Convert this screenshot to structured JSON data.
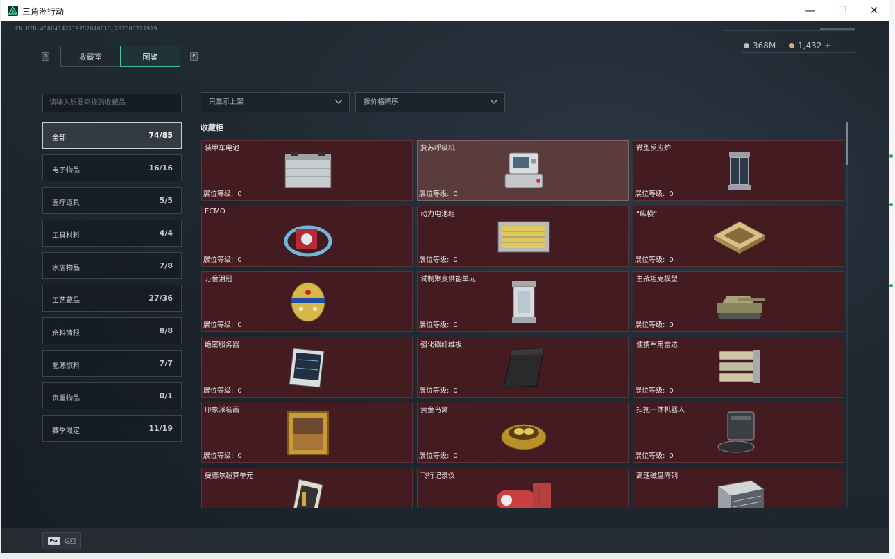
{
  "window": {
    "title": "三角洲行动",
    "minimize": "—",
    "maximize": "☐",
    "close": "✕"
  },
  "header": {
    "uid": "CN UID:4506414221925204081​3_202603221919",
    "silver": "368M",
    "gold": "1,432 +"
  },
  "tabs": {
    "key_left": "Q",
    "key_right": "E",
    "archive": "收藏室",
    "dex": "图鉴"
  },
  "filters": {
    "search_placeholder": "请输入想要查找的收藏品",
    "filter_dropdown": "只显示上架",
    "sort_dropdown": "按价格降序"
  },
  "categories": [
    {
      "name": "全部",
      "count": "74/85"
    },
    {
      "name": "电子物品",
      "count": "16/16"
    },
    {
      "name": "医疗道具",
      "count": "5/5"
    },
    {
      "name": "工具材料",
      "count": "4/4"
    },
    {
      "name": "家居物品",
      "count": "7/8"
    },
    {
      "name": "工艺藏品",
      "count": "27/36"
    },
    {
      "name": "资料情报",
      "count": "8/8"
    },
    {
      "name": "能源燃料",
      "count": "7/7"
    },
    {
      "name": "贵重物品",
      "count": "0/1"
    },
    {
      "name": "赛季限定",
      "count": "11/19"
    }
  ],
  "section": {
    "title": "收藏柜"
  },
  "level_label": "展位等级:",
  "items": [
    {
      "name": "装甲车电池",
      "level": "0",
      "icon": "battery-icon"
    },
    {
      "name": "复苏呼吸机",
      "level": "0",
      "icon": "ventilator-icon"
    },
    {
      "name": "微型反应炉",
      "level": "0",
      "icon": "reactor-icon"
    },
    {
      "name": "ECMO",
      "level": "0",
      "icon": "ecmo-icon"
    },
    {
      "name": "动力电池组",
      "level": "0",
      "icon": "battery-pack-icon"
    },
    {
      "name": "“纵横”",
      "level": "0",
      "icon": "chessboard-icon"
    },
    {
      "name": "万金泪冠",
      "level": "0",
      "icon": "jeweled-egg-icon"
    },
    {
      "name": "试制聚变供能单元",
      "level": "0",
      "icon": "fusion-cell-icon"
    },
    {
      "name": "主战坦克模型",
      "level": "0",
      "icon": "tank-icon"
    },
    {
      "name": "绝密服务器",
      "level": "0",
      "icon": "server-icon"
    },
    {
      "name": "强化碳纤维板",
      "level": "0",
      "icon": "carbon-plate-icon"
    },
    {
      "name": "便携军用雷达",
      "level": "0",
      "icon": "radar-icon"
    },
    {
      "name": "印象派名画",
      "level": "0",
      "icon": "painting-icon"
    },
    {
      "name": "黄金鸟窝",
      "level": "0",
      "icon": "golden-nest-icon"
    },
    {
      "name": "扫拖一体机器人",
      "level": "0",
      "icon": "robot-vacuum-icon"
    },
    {
      "name": "曼德尔超算单元",
      "level": "",
      "icon": "supercomputer-icon"
    },
    {
      "name": "飞行记录仪",
      "level": "",
      "icon": "flight-recorder-icon"
    },
    {
      "name": "高速磁盘阵列",
      "level": "",
      "icon": "disk-array-icon"
    }
  ],
  "footer": {
    "esc_key": "Esc",
    "esc_label": "返回"
  },
  "colors": {
    "accent": "#3fc3a0",
    "card_bg": "#431b20",
    "card_highlight": "#5b3c3d"
  }
}
